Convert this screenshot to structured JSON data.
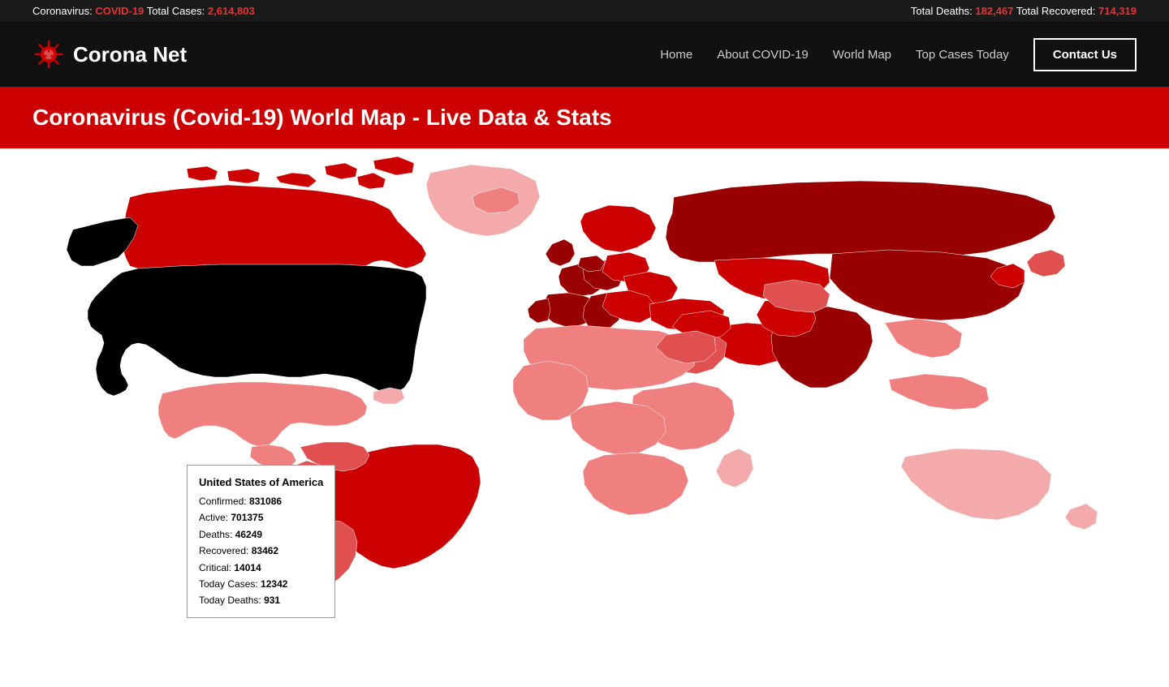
{
  "statsBar": {
    "label": "Coronavirus:",
    "covidLabel": "COVID-19",
    "totalCasesLabel": "Total Cases:",
    "totalCases": "2,614,803",
    "totalDeathsLabel": "Total Deaths:",
    "totalDeaths": "182,467",
    "totalRecoveredLabel": "Total Recovered:",
    "totalRecovered": "714,319"
  },
  "navbar": {
    "logoText": "Corona Net",
    "links": [
      {
        "label": "Home",
        "name": "home-link"
      },
      {
        "label": "About COVID-19",
        "name": "about-link"
      },
      {
        "label": "World Map",
        "name": "worldmap-link"
      },
      {
        "label": "Top Cases Today",
        "name": "topcases-link"
      }
    ],
    "contactBtn": "Contact Us"
  },
  "banner": {
    "title": "Coronavirus (Covid-19) World Map - Live Data & Stats"
  },
  "tooltip": {
    "country": "United States of America",
    "confirmedLabel": "Confirmed:",
    "confirmed": "831086",
    "activeLabel": "Active:",
    "active": "701375",
    "deathsLabel": "Deaths:",
    "deaths": "46249",
    "recoveredLabel": "Recovered:",
    "recovered": "83462",
    "criticalLabel": "Critical:",
    "critical": "14014",
    "todayCasesLabel": "Today Cases:",
    "todayCases": "12342",
    "todayDeathsLabel": "Today Deaths:",
    "todayDeaths": "931"
  }
}
